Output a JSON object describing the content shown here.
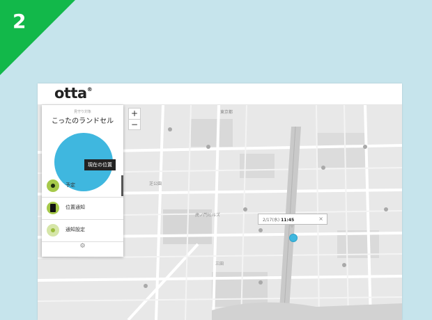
{
  "step": {
    "number": "2",
    "color": "#12b84a"
  },
  "app": {
    "logo": "otta",
    "logo_mark": "®"
  },
  "map": {
    "zoom_in_label": "+",
    "zoom_out_label": "−",
    "labels": [
      "東京都",
      "虎ノ門ヒルズ",
      "三田",
      "芝公園"
    ]
  },
  "panel": {
    "subtitle": "見守り対象",
    "title": "こったのランドセル",
    "location_badge": "現在の位置",
    "items": [
      {
        "label": "予定",
        "icon": "location-dot-icon"
      },
      {
        "label": "位置通知",
        "icon": "phone-icon"
      },
      {
        "label": "通知設定",
        "icon": "settings-dot-icon"
      }
    ],
    "footer_icon": "gear-icon"
  },
  "popup": {
    "prefix": "2/17(水)",
    "time": "11:45",
    "close": "×"
  },
  "colors": {
    "accent": "#3fb7df",
    "green": "#a6c94a"
  }
}
